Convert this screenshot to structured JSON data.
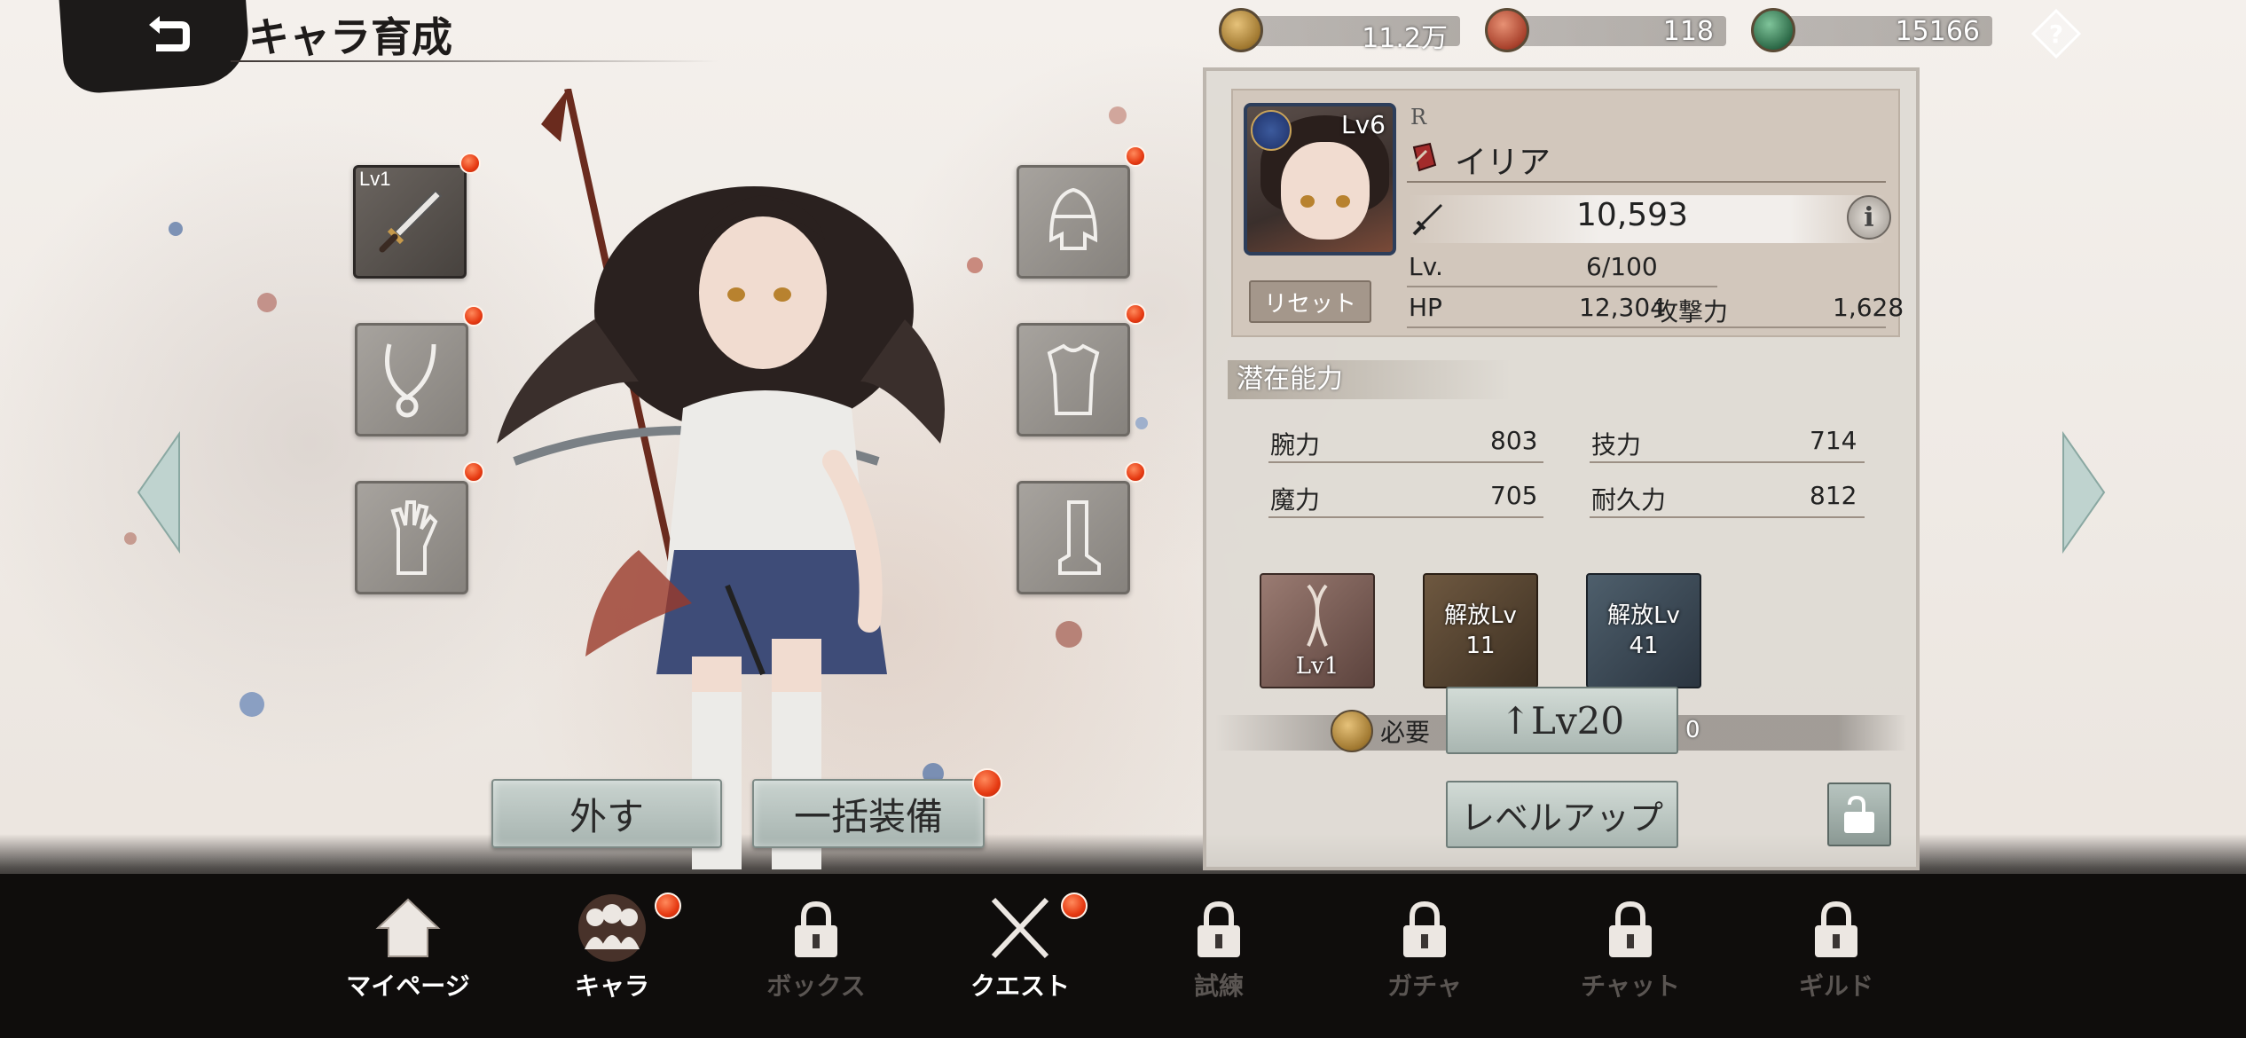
{
  "header": {
    "title": "キャラ育成",
    "back_icon": "back-arrow-icon",
    "help_icon": "question-diamond-icon"
  },
  "currencies": [
    {
      "name": "gold-coin",
      "amount": "11.2万",
      "color": "#c49a4c"
    },
    {
      "name": "red-orb",
      "amount": "118",
      "color": "#b8523a"
    },
    {
      "name": "green-orb",
      "amount": "15166",
      "color": "#3f7a58"
    }
  ],
  "equipment": {
    "weapon": {
      "level": "Lv1",
      "icon": "sword-icon"
    },
    "left": [
      {
        "icon": "necklace-icon"
      },
      {
        "icon": "glove-icon"
      }
    ],
    "right": [
      {
        "icon": "helmet-icon"
      },
      {
        "icon": "armor-icon"
      },
      {
        "icon": "boot-icon"
      }
    ]
  },
  "actions": {
    "unequip_label": "外す",
    "equip_all_label": "一括装備"
  },
  "character": {
    "rarity": "R",
    "name": "イリア",
    "portrait_level": "Lv6",
    "power": "10,593",
    "reset_label": "リセット",
    "lv_label": "Lv.",
    "lv_value": "6/100",
    "hp_label": "HP",
    "hp_value": "12,304",
    "atk_label": "攻撃力",
    "atk_value": "1,628",
    "info_label": "i"
  },
  "potential": {
    "title": "潜在能力",
    "stats": [
      {
        "label": "腕力",
        "value": "803"
      },
      {
        "label": "技力",
        "value": "714"
      },
      {
        "label": "魔力",
        "value": "705"
      },
      {
        "label": "耐久力",
        "value": "812"
      }
    ]
  },
  "abilities": [
    {
      "label": "Lv1",
      "color": "#8a6a62"
    },
    {
      "label1": "解放Lv",
      "label2": "11",
      "color": "#5f4b38"
    },
    {
      "label1": "解放Lv",
      "label2": "41",
      "color": "#3e4d5a"
    }
  ],
  "upgrade": {
    "need_label": "必要",
    "level_up_target": "↑Lv20",
    "need_value": "0",
    "level_up_label": "レベルアップ"
  },
  "nav": [
    {
      "label": "マイページ",
      "icon": "home-icon",
      "locked": false,
      "badge": false
    },
    {
      "label": "キャラ",
      "icon": "characters-icon",
      "locked": false,
      "badge": true
    },
    {
      "label": "ボックス",
      "icon": "lock-icon",
      "locked": true,
      "badge": false
    },
    {
      "label": "クエスト",
      "icon": "crossed-swords-icon",
      "locked": false,
      "badge": true
    },
    {
      "label": "試練",
      "icon": "lock-icon",
      "locked": true,
      "badge": false
    },
    {
      "label": "ガチャ",
      "icon": "lock-icon",
      "locked": true,
      "badge": false
    },
    {
      "label": "チャット",
      "icon": "lock-icon",
      "locked": true,
      "badge": false
    },
    {
      "label": "ギルド",
      "icon": "lock-icon",
      "locked": true,
      "badge": false
    }
  ]
}
